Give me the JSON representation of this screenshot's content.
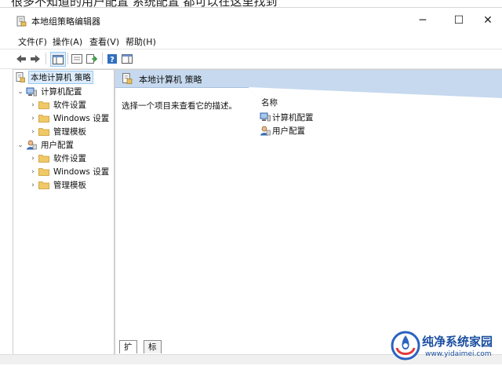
{
  "article": {
    "text": "很多不知道的用户配置 系统配置 都可以在这里找到"
  },
  "window": {
    "title": "本地组策略编辑器",
    "controls": {
      "minimize": "─",
      "maximize": "☐",
      "close": "✕"
    }
  },
  "menu": [
    {
      "label": "文件(F)"
    },
    {
      "label": "操作(A)"
    },
    {
      "label": "查看(V)"
    },
    {
      "label": "帮助(H)"
    }
  ],
  "toolbar": {
    "icons": [
      "back-arrow-icon",
      "forward-arrow-icon",
      "show-hide-tree-icon",
      "properties-icon",
      "export-list-icon",
      "help-icon",
      "show-action-pane-icon"
    ]
  },
  "tree": {
    "root": "本地计算机 策略",
    "computer": "计算机配置",
    "user": "用户配置",
    "computer_children": [
      "软件设置",
      "Windows 设置",
      "管理模板"
    ],
    "user_children": [
      "软件设置",
      "Windows 设置",
      "管理模板"
    ]
  },
  "right": {
    "header": "本地计算机 策略",
    "description": "选择一个项目来查看它的描述。",
    "column_name": "名称",
    "items": [
      {
        "label": "计算机配置"
      },
      {
        "label": "用户配置"
      }
    ]
  },
  "tabs": [
    {
      "label": "扩展"
    },
    {
      "label": "标准"
    }
  ],
  "watermark": {
    "title": "纯净系统家园",
    "url": "www.yidaimei.com"
  },
  "colors": {
    "header_bg": "#c6d9ef",
    "selection_bg": "#dcecfc",
    "folder": "#e8c060",
    "brand": "#1c4fa0"
  }
}
